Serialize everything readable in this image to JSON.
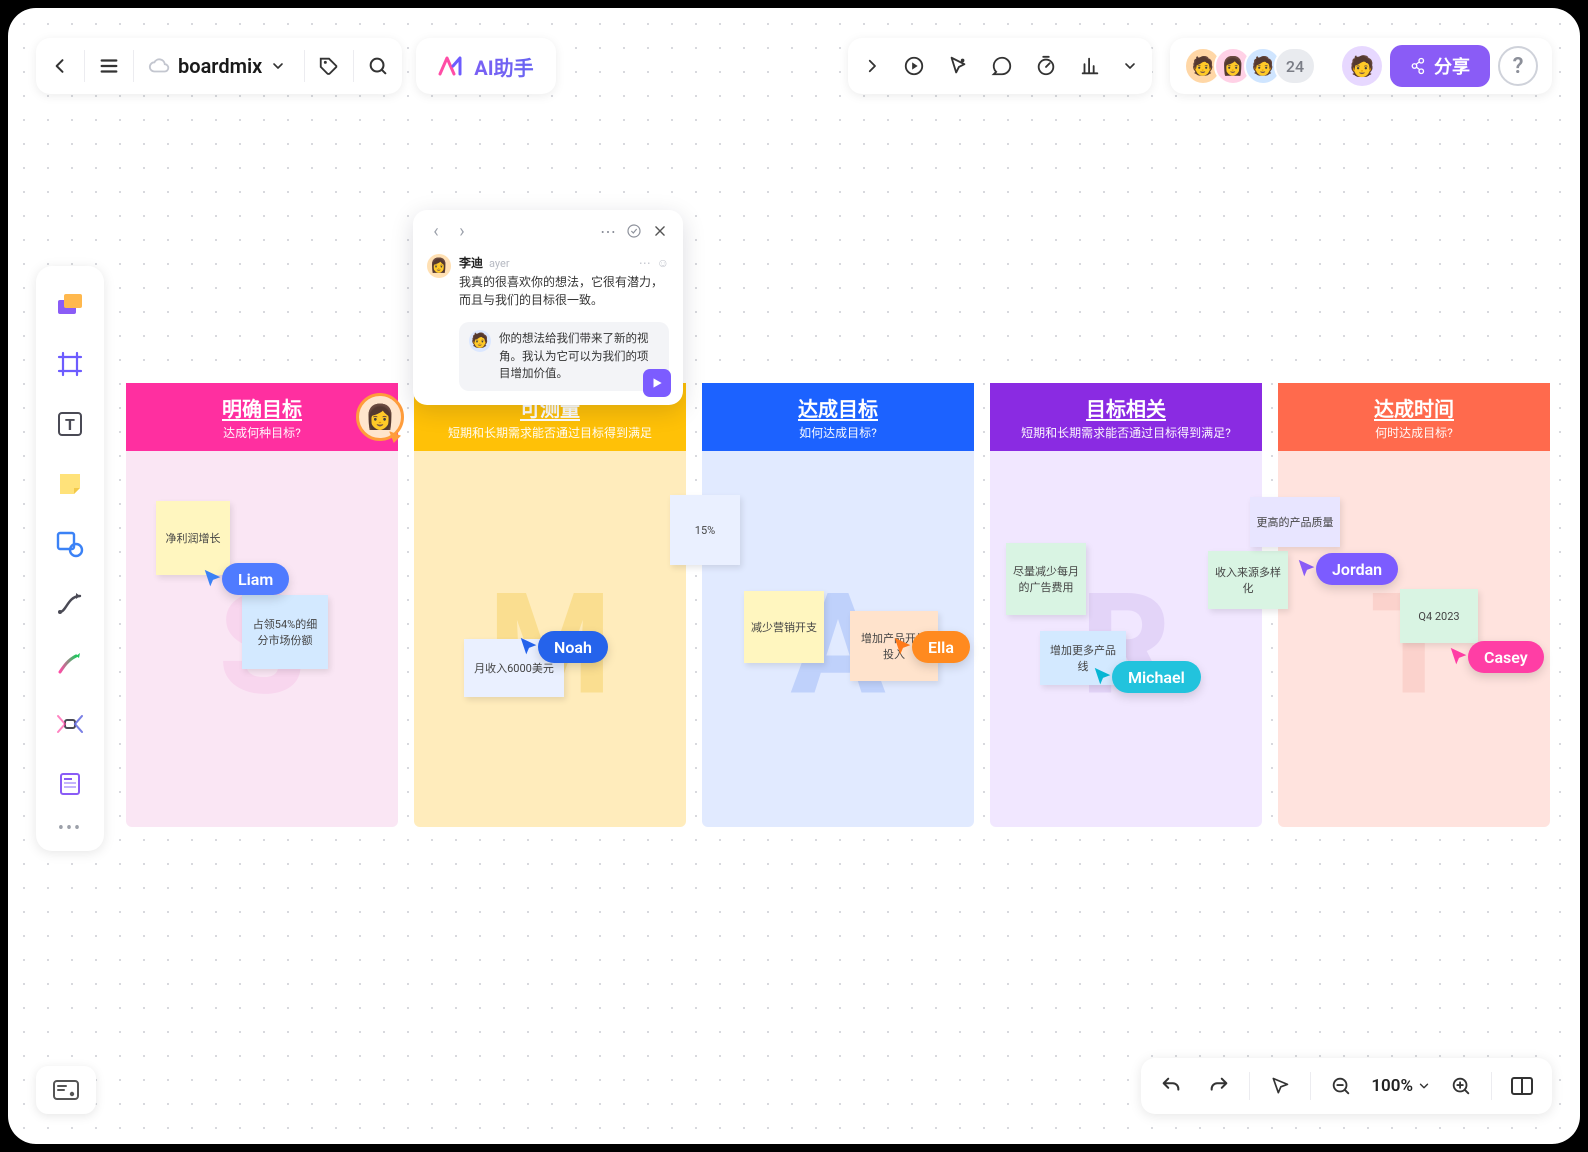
{
  "app": {
    "title": "boardmix",
    "ai_label": "AI助手",
    "avatar_count": "24",
    "share_label": "分享",
    "zoom": "100%"
  },
  "columns": [
    {
      "letter": "S",
      "title": "明确目标",
      "subtitle": "达成何种目标?"
    },
    {
      "letter": "M",
      "title": "可测量",
      "subtitle": "短期和长期需求能否通过目标得到满足"
    },
    {
      "letter": "A",
      "title": "达成目标",
      "subtitle": "如何达成目标?"
    },
    {
      "letter": "R",
      "title": "目标相关",
      "subtitle": "短期和长期需求能否通过目标得到满足?"
    },
    {
      "letter": "T",
      "title": "达成时间",
      "subtitle": "何时达成目标?"
    }
  ],
  "notes": {
    "s1": "净利润增长",
    "s2": "占领54%的细分市场份额",
    "m1": "月收入6000美元",
    "a1": "15%",
    "a2": "减少营销开支",
    "a3": "增加产品开发投入",
    "r1": "尽量减少每月的广告费用",
    "r2": "增加更多产品线",
    "t1": "更高的产品质量",
    "t2": "收入来源多样化",
    "t3": "Q4 2023"
  },
  "cursors": {
    "liam": "Liam",
    "noah": "Noah",
    "ella": "Ella",
    "michael": "Michael",
    "jordan": "Jordan",
    "casey": "Casey"
  },
  "comment": {
    "author": "李迪",
    "time": "ayer",
    "text": "我真的很喜欢你的想法，它很有潜力，而且与我们的目标很一致。",
    "reply": "你的想法给我们带来了新的视角。我认为它可以为我们的项目增加价值。"
  }
}
